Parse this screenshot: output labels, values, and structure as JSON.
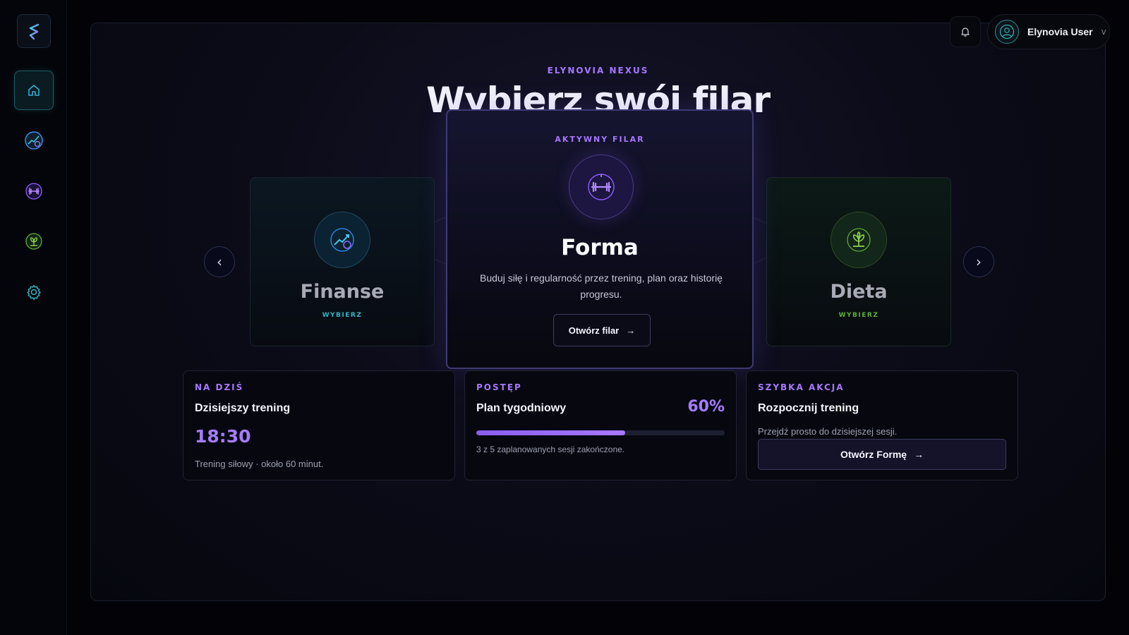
{
  "app": {
    "brand_eyebrow": "ELYNOVIA NEXUS",
    "heading": "Wybierz swój filar"
  },
  "sidebar": {
    "logo_icon": "brand-s-logo-icon",
    "items": [
      {
        "id": "home",
        "icon": "home-icon",
        "active": true
      },
      {
        "id": "finance",
        "icon": "finance-chart-icon",
        "active": false
      },
      {
        "id": "fitness",
        "icon": "dumbbell-icon",
        "active": false
      },
      {
        "id": "diet",
        "icon": "leaf-icon",
        "active": false
      },
      {
        "id": "settings",
        "icon": "gear-icon",
        "active": false
      }
    ]
  },
  "header": {
    "notification_icon": "bell-icon",
    "user_name": "Elynovia User",
    "user_chevron": "v"
  },
  "carousel": {
    "prev_label": "‹",
    "next_label": "›",
    "active": {
      "eyebrow": "AKTYWNY FILAR",
      "title": "Forma",
      "description": "Buduj siłę i regularność przez trening, plan oraz historię progresu.",
      "button_label": "Otwórz filar",
      "button_arrow": "→"
    },
    "left": {
      "title": "Finanse",
      "sub": "WYBIERZ"
    },
    "right": {
      "title": "Dieta",
      "sub": "WYBIERZ"
    }
  },
  "cards": {
    "today": {
      "eyebrow": "NA DZIŚ",
      "title": "Dzisiejszy trening",
      "time": "18:30",
      "note": "Trening siłowy · około 60 minut."
    },
    "progress": {
      "eyebrow": "POSTĘP",
      "title": "Plan tygodniowy",
      "percent_label": "60%",
      "percent_value": 0.6,
      "note": "3 z 5 zaplanowanych sesji zakończone."
    },
    "quick": {
      "eyebrow": "SZYBKA AKCJA",
      "title": "Rozpocznij trening",
      "desc": "Przejdź prosto do dzisiejszej sesji.",
      "button_label": "Otwórz Formę",
      "button_arrow": "→"
    }
  },
  "colors": {
    "accent": "#a678ff",
    "finance": "#2fb6c6",
    "diet": "#7dcf3a"
  }
}
